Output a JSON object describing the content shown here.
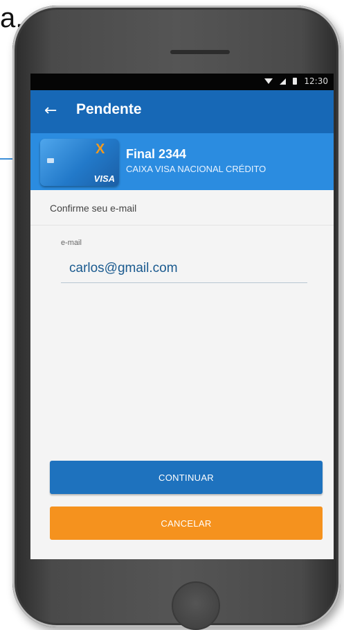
{
  "caption_fragment": "a.",
  "status_bar": {
    "time": "12:30"
  },
  "appbar": {
    "back_icon": "arrow-left-icon",
    "title": "Pendente"
  },
  "card": {
    "title": "Final 2344",
    "subtitle": "CAIXA VISA NACIONAL CRÉDITO",
    "brand_mark": "X",
    "network": "VISA"
  },
  "form": {
    "section_label": "Confirme seu e-mail",
    "email_label": "e-mail",
    "email_value": "carlos@gmail.com"
  },
  "buttons": {
    "continue_label": "CONTINUAR",
    "cancel_label": "CANCELAR"
  },
  "colors": {
    "appbar": "#1768b6",
    "card_header": "#2b8ce0",
    "continue": "#1e72be",
    "cancel": "#f5921e"
  }
}
